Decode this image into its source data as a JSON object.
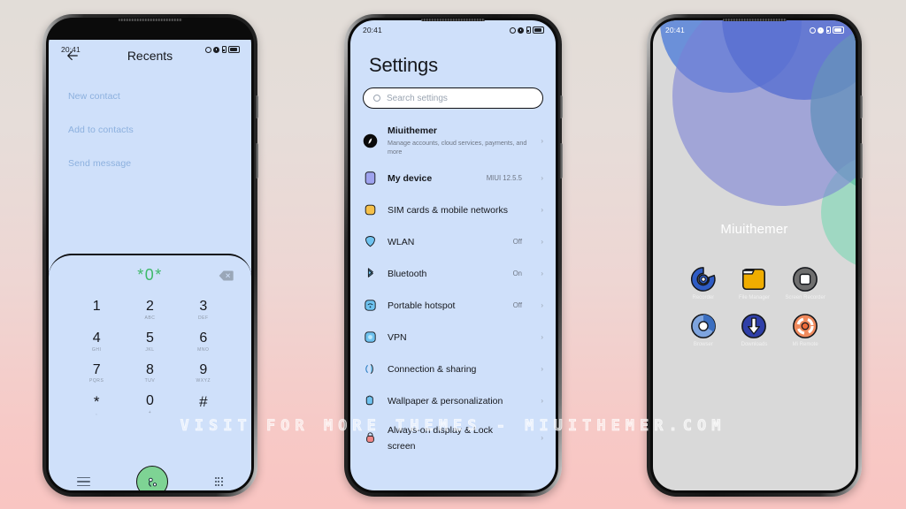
{
  "background": {
    "top_color": "#e2ddd8",
    "bottom_color": "#f9c5c2"
  },
  "watermark": {
    "text": "VISIT FOR MORE THEMES - MIUITHEMER.COM"
  },
  "status_bar": {
    "time": "20:41",
    "icons": [
      "circle-outline-icon",
      "circle-filled-icon",
      "signal-icon",
      "battery-icon"
    ]
  },
  "phone1": {
    "name": "Dialer Recents screen",
    "header": {
      "back_label": "back-arrow",
      "title": "Recents"
    },
    "actions": [
      {
        "label": "New contact"
      },
      {
        "label": "Add to contacts"
      },
      {
        "label": "Send message"
      }
    ],
    "dialer": {
      "number": "*0*",
      "backspace": "backspace-icon",
      "keys": [
        {
          "num": "1",
          "sub": ""
        },
        {
          "num": "2",
          "sub": "ABC"
        },
        {
          "num": "3",
          "sub": "DEF"
        },
        {
          "num": "4",
          "sub": "GHI"
        },
        {
          "num": "5",
          "sub": "JKL"
        },
        {
          "num": "6",
          "sub": "MNO"
        },
        {
          "num": "7",
          "sub": "PQRS"
        },
        {
          "num": "8",
          "sub": "TUV"
        },
        {
          "num": "9",
          "sub": "WXYZ"
        },
        {
          "num": "*",
          "sub": ","
        },
        {
          "num": "0",
          "sub": "+"
        },
        {
          "num": "#",
          "sub": ""
        }
      ],
      "bottom": {
        "menu": "menu-icon",
        "call": "call-icon",
        "keypad": "keypad-icon"
      },
      "call_button_color": "#7ed394",
      "number_color": "#3fb96a"
    }
  },
  "phone2": {
    "name": "Settings screen",
    "title": "Settings",
    "search": {
      "placeholder": "Search settings"
    },
    "items": [
      {
        "label": "Miuithemer",
        "desc": "Manage accounts, cloud services, payments, and more",
        "value": "",
        "icon": "account-avatar-icon"
      },
      {
        "label": "My device",
        "desc": "",
        "value": "MIUI 12.5.5",
        "icon": "device-icon"
      },
      {
        "label": "SIM cards & mobile networks",
        "desc": "",
        "value": "",
        "icon": "sim-card-icon"
      },
      {
        "label": "WLAN",
        "desc": "",
        "value": "Off",
        "icon": "wifi-shield-icon"
      },
      {
        "label": "Bluetooth",
        "desc": "",
        "value": "On",
        "icon": "bluetooth-icon"
      },
      {
        "label": "Portable hotspot",
        "desc": "",
        "value": "Off",
        "icon": "hotspot-icon"
      },
      {
        "label": "VPN",
        "desc": "",
        "value": "",
        "icon": "vpn-icon"
      },
      {
        "label": "Connection & sharing",
        "desc": "",
        "value": "",
        "icon": "connection-sharing-icon"
      },
      {
        "label": "Wallpaper & personalization",
        "desc": "",
        "value": "",
        "icon": "wallpaper-icon"
      },
      {
        "label": "Always-on display & Lock screen",
        "desc": "",
        "value": "",
        "icon": "lock-screen-icon"
      }
    ]
  },
  "phone3": {
    "name": "Home screen",
    "title": "Miuithemer",
    "apps": [
      {
        "label": "Recorder",
        "icon": "recorder-icon",
        "color": "#2f5cc4"
      },
      {
        "label": "File Manager",
        "icon": "file-manager-icon",
        "color": "#f0ad00"
      },
      {
        "label": "Screen Recorder",
        "icon": "screen-recorder-icon",
        "color": "#6f6f6f"
      },
      {
        "label": "Browser",
        "icon": "browser-icon",
        "color": "#7ea4de"
      },
      {
        "label": "Downloads",
        "icon": "downloads-icon",
        "color": "#2f3fa8"
      },
      {
        "label": "Mi Remote",
        "icon": "mi-remote-icon",
        "color": "#f08a5d"
      }
    ]
  }
}
